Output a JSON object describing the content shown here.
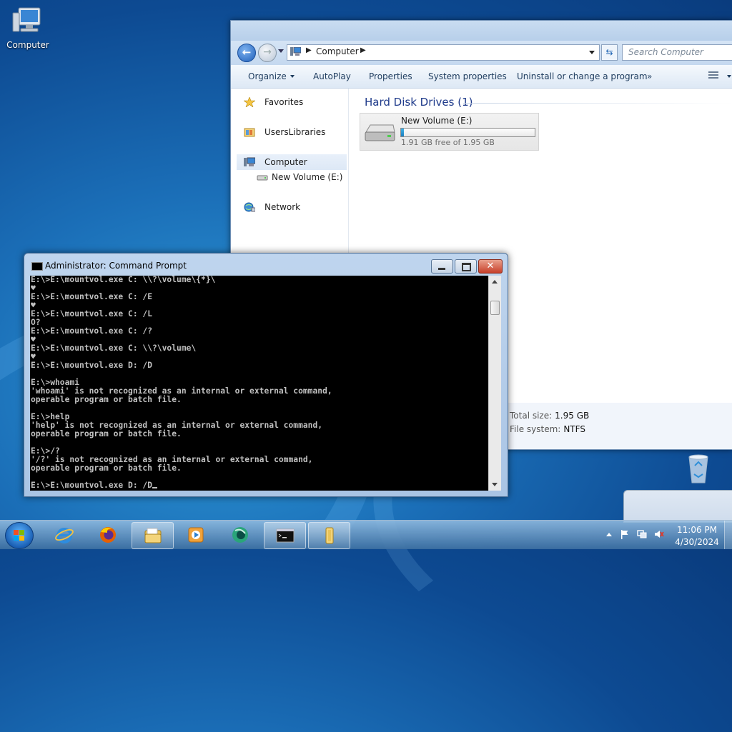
{
  "desktop": {
    "icons": [
      {
        "label": "Computer",
        "icon": "computer-icon"
      },
      {
        "label": "Recycle Bin",
        "icon": "recycle-bin-icon"
      }
    ]
  },
  "explorer": {
    "address": {
      "location": "Computer"
    },
    "search": {
      "placeholder": "Search Computer"
    },
    "toolbar": {
      "organize": "Organize",
      "autoplay": "AutoPlay",
      "properties": "Properties",
      "system_properties": "System properties",
      "uninstall": "Uninstall or change a program",
      "more": "»"
    },
    "nav": {
      "favorites": "Favorites",
      "libraries": "UsersLibraries",
      "computer": "Computer",
      "new_volume": "New Volume (E:)",
      "network": "Network"
    },
    "content": {
      "group_title": "Hard Disk Drives (1)",
      "drive": {
        "name": "New Volume (E:)",
        "free_text": "1.91 GB free of 1.95 GB",
        "used_fraction": 0.02
      }
    },
    "details": {
      "total_size_label": "Total size:",
      "total_size_value": "1.95 GB",
      "fs_label": "File system:",
      "fs_value": "NTFS"
    }
  },
  "cmd": {
    "title": "Administrator: Command Prompt",
    "output": "E:\\>E:\\mountvol.exe C: \\\\?\\volume\\{*}\\\n♥\nE:\\>E:\\mountvol.exe C: /E\n♥\nE:\\>E:\\mountvol.exe C: /L\nO?\nE:\\>E:\\mountvol.exe C: /?\n♥\nE:\\>E:\\mountvol.exe C: \\\\?\\volume\\\n♥\nE:\\>E:\\mountvol.exe D: /D\n\nE:\\>whoami\n'whoami' is not recognized as an internal or external command,\noperable program or batch file.\n\nE:\\>help\n'help' is not recognized as an internal or external command,\noperable program or batch file.\n\nE:\\>/?\n'/?' is not recognized as an internal or external command,\noperable program or batch file.\n\nE:\\>E:\\mountvol.exe D: /D",
    "close_glyph": "✕"
  },
  "taskbar": {
    "clock_time": "11:06 PM",
    "clock_date": "4/30/2024"
  }
}
